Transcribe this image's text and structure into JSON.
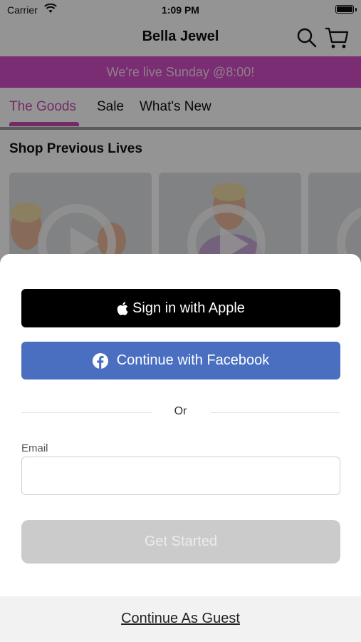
{
  "status_bar": {
    "carrier": "Carrier",
    "time": "1:09 PM"
  },
  "nav": {
    "title": "Bella Jewel"
  },
  "promo": {
    "text": "We're live Sunday @8:00!",
    "color": "#d34fc4"
  },
  "tabs": [
    {
      "label": "The Goods",
      "active": true
    },
    {
      "label": "Sale",
      "active": false
    },
    {
      "label": "What's New",
      "active": false
    }
  ],
  "section": {
    "title": "Shop Previous Lives"
  },
  "sheet": {
    "apple_label": "Sign in with Apple",
    "facebook_label": "Continue with Facebook",
    "or_text": "Or",
    "email_label": "Email",
    "email_value": "",
    "get_started_label": "Get Started",
    "guest_label": "Continue As Guest"
  },
  "colors": {
    "accent": "#c54bb0",
    "facebook": "#4a6fc1",
    "apple": "#000000"
  }
}
